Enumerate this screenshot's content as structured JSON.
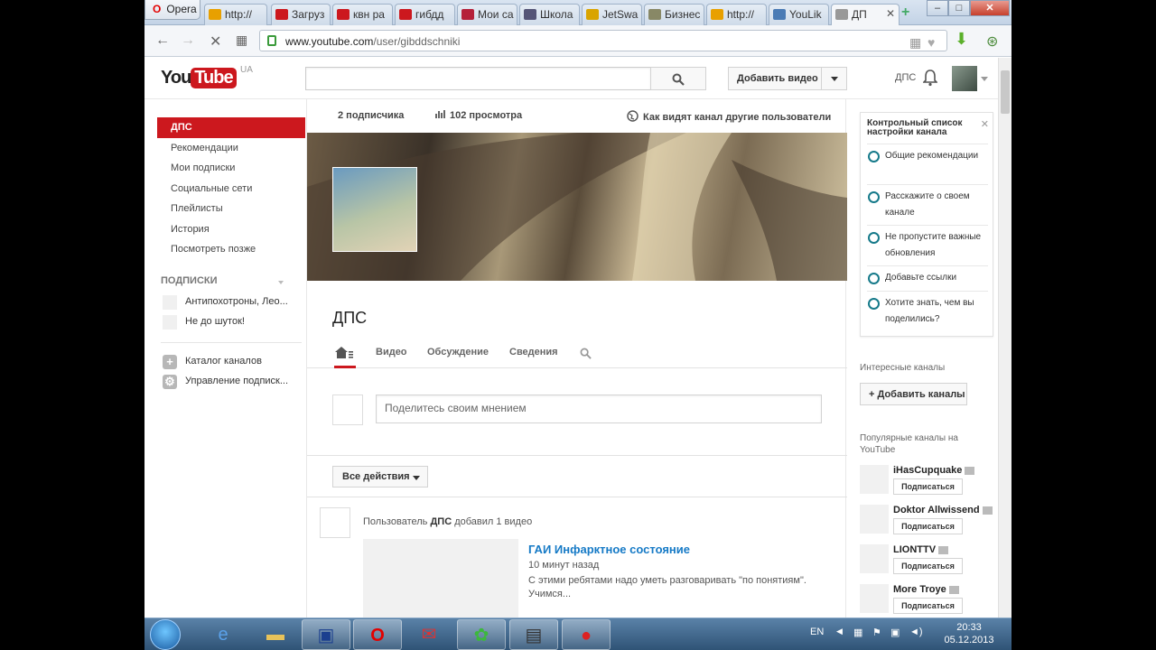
{
  "browser": {
    "menu_label": "Opera",
    "tabs": [
      {
        "label": "http://",
        "icon": "yellow-thumb-icon",
        "color": "#e8a000"
      },
      {
        "label": "Загруз",
        "icon": "youtube-icon",
        "color": "#cc181e"
      },
      {
        "label": "квн ра",
        "icon": "youtube-icon",
        "color": "#cc181e"
      },
      {
        "label": "гибдд",
        "icon": "youtube-icon",
        "color": "#cc181e"
      },
      {
        "label": "Мои са",
        "icon": "red-site-icon",
        "color": "#b5213a"
      },
      {
        "label": "Школа",
        "icon": "book-icon",
        "color": "#557"
      },
      {
        "label": "JetSwa",
        "icon": "jetswap-icon",
        "color": "#d9a400"
      },
      {
        "label": "Бизнес",
        "icon": "home-icon",
        "color": "#886"
      },
      {
        "label": "http://",
        "icon": "yellow-thumb-icon",
        "color": "#e8a000"
      },
      {
        "label": "YouLik",
        "icon": "youlike-icon",
        "color": "#4a7bb5"
      },
      {
        "label": "ДП",
        "icon": "loading-icon",
        "color": "#999"
      }
    ],
    "url_host": "www.youtube.com",
    "url_path": "/user/gibddschniki"
  },
  "youtube": {
    "logo_you": "You",
    "logo_tube": "Tube",
    "logo_region": "UA",
    "upload_label": "Добавить видео",
    "user_name": "ДПС"
  },
  "guide": {
    "items": [
      "ДПС",
      "Рекомендации",
      "Мои подписки",
      "Социальные сети",
      "Плейлисты",
      "История",
      "Посмотреть позже"
    ],
    "subs_heading": "ПОДПИСКИ",
    "subscriptions": [
      "Антипохотроны, Лео...",
      "Не до шуток!"
    ],
    "catalog": "Каталог каналов",
    "manage": "Управление подписк..."
  },
  "channel": {
    "subscribers": "2 подписчика",
    "views": "102 просмотра",
    "view_as": "Как видят канал другие пользователи",
    "name": "ДПС",
    "tabs": [
      "Видео",
      "Обсуждение",
      "Сведения"
    ],
    "share_placeholder": "Поделитесь своим мнением",
    "all_actions": "Все действия",
    "feed": {
      "prefix": "Пользователь",
      "user": "ДПС",
      "action": "добавил 1 видео",
      "video_title": "ГАИ Инфарктное состояние",
      "video_time": "10 минут назад",
      "video_desc": "С этими ребятами надо уметь разговаривать \"по понятиям\". Учимся..."
    }
  },
  "checklist": {
    "title": "Контрольный список настройки канала",
    "items": [
      "Общие рекомендации",
      "Расскажите о своем канале",
      "Не пропустите важные обновления",
      "Добавьте ссылки",
      "Хотите знать, чем вы поделились?"
    ]
  },
  "sidebar": {
    "interesting": "Интересные каналы",
    "add_channels": "+ Добавить каналы",
    "popular": "Популярные каналы на YouTube",
    "subscribe_label": "Подписаться",
    "channels": [
      "iHasCupquake",
      "Doktor Allwissend",
      "LIONTTV",
      "More Troye"
    ]
  },
  "taskbar": {
    "lang": "EN",
    "time": "20:33",
    "date": "05.12.2013"
  },
  "colors": {
    "youtube_red": "#cc181e",
    "link_blue": "#167ac6",
    "checklist_ring": "#167a8a"
  }
}
